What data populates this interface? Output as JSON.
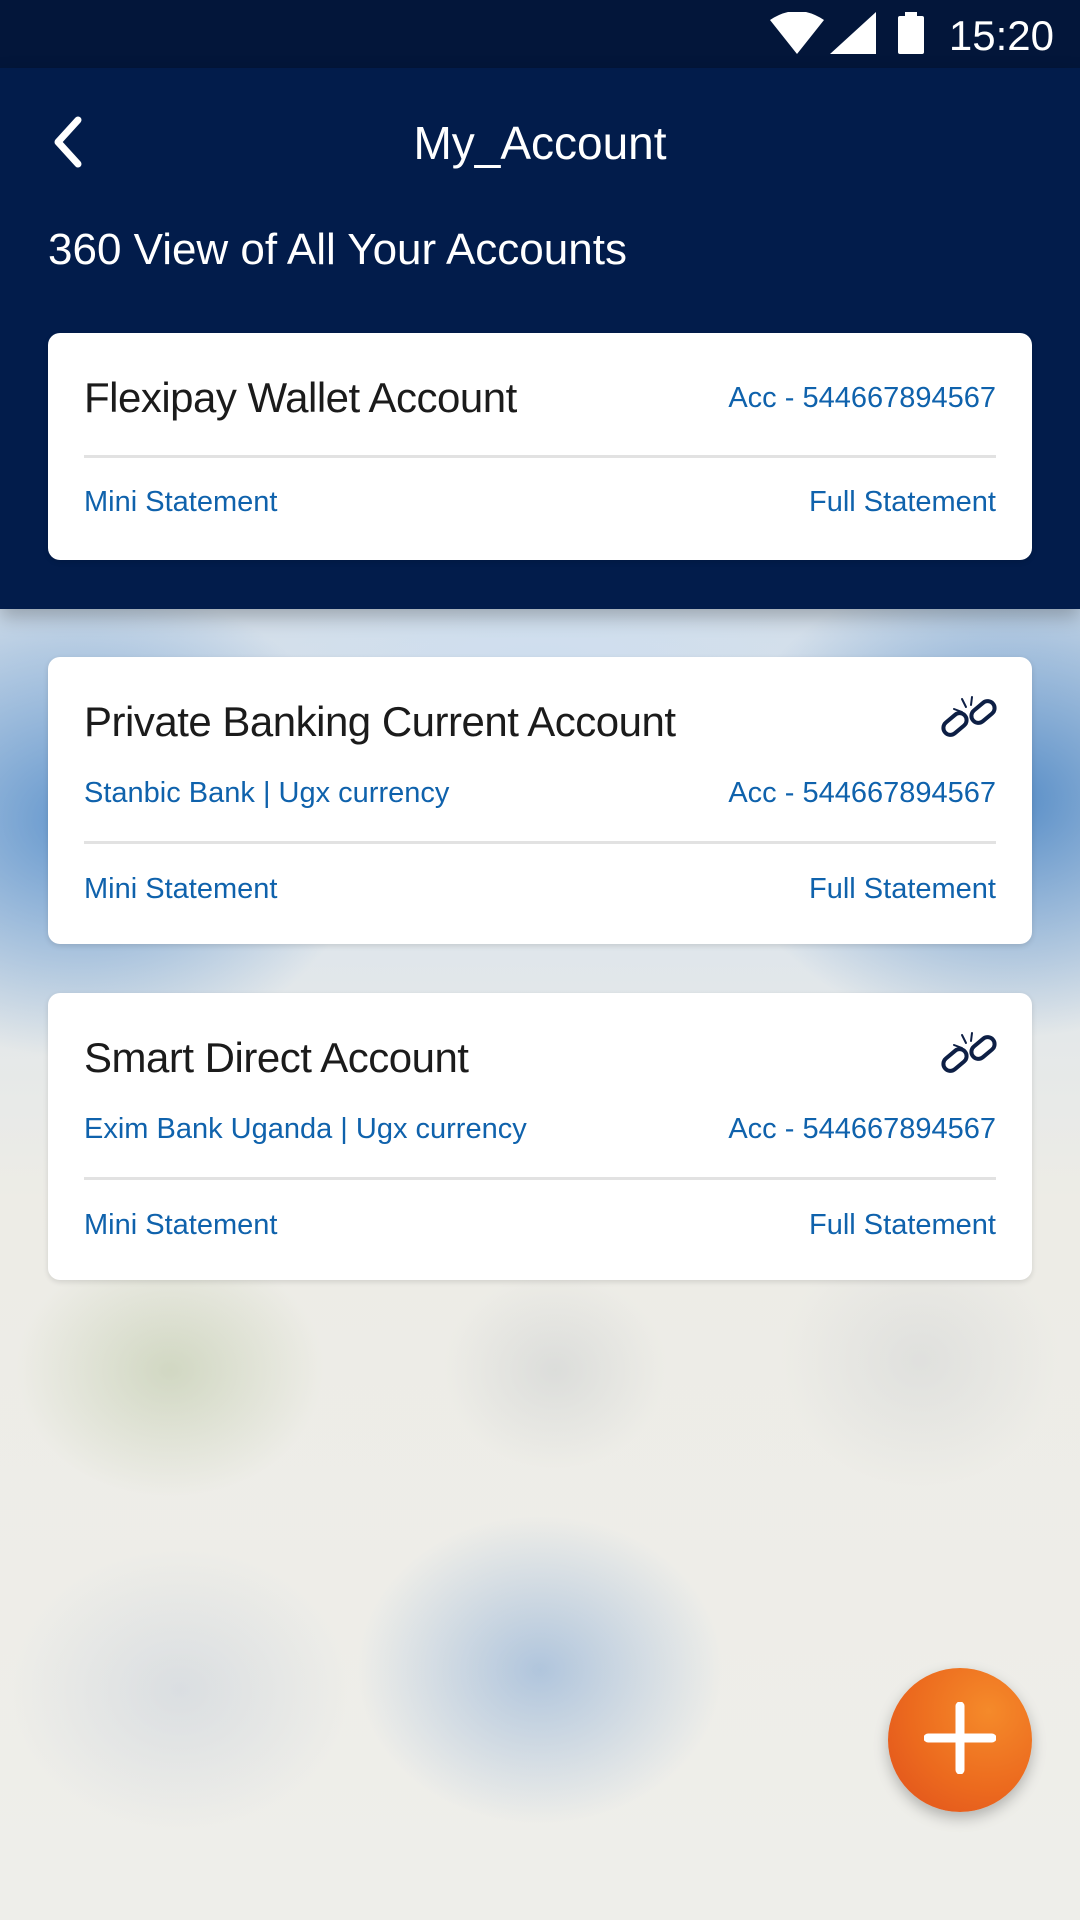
{
  "status_bar": {
    "time": "15:20",
    "icons": [
      "wifi-icon",
      "cellular-signal-icon",
      "battery-icon"
    ]
  },
  "header": {
    "title": "My_Account",
    "subtitle": "360 View of All Your Accounts",
    "back_icon": "back-chevron-icon",
    "background_color": "#021c4b"
  },
  "accounts": [
    {
      "name": "Flexipay Wallet Account",
      "account": "Acc - 544667894567",
      "mini_statement": "Mini Statement",
      "full_statement": "Full Statement"
    },
    {
      "name": "Private Banking Current Account",
      "bank_info": "Stanbic Bank | Ugx currency",
      "account": "Acc - 544667894567",
      "mini_statement": "Mini Statement",
      "full_statement": "Full Statement",
      "icon": "unlink-icon"
    },
    {
      "name": "Smart Direct Account",
      "bank_info": "Exim Bank Uganda | Ugx currency",
      "account": "Acc - 544667894567",
      "mini_statement": "Mini Statement",
      "full_statement": "Full Statement",
      "icon": "unlink-icon"
    }
  ],
  "fab": {
    "icon": "plus-icon",
    "color": "#ec6a1e"
  },
  "colors": {
    "link": "#0f62ac",
    "title_text": "#1b1b1b"
  }
}
